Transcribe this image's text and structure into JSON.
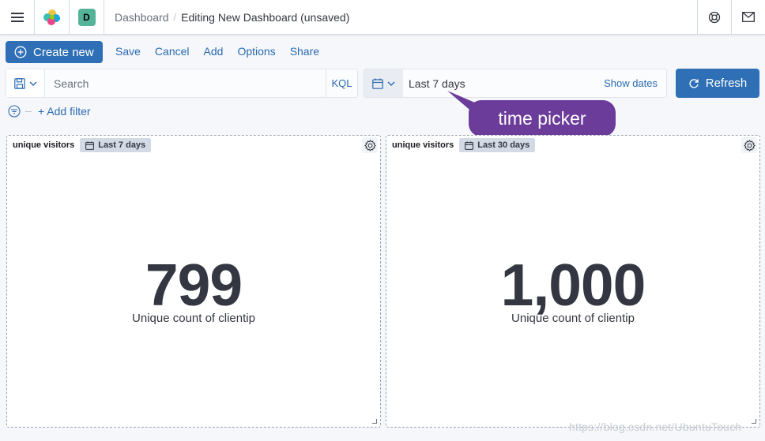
{
  "header": {
    "space_initial": "D",
    "breadcrumbs": [
      "Dashboard",
      "Editing New Dashboard (unsaved)"
    ]
  },
  "top_nav": {
    "create_new": "Create new",
    "links": [
      "Save",
      "Cancel",
      "Add",
      "Options",
      "Share"
    ]
  },
  "query_bar": {
    "search_placeholder": "Search",
    "language": "KQL"
  },
  "date_picker": {
    "label": "Last 7 days",
    "show_dates": "Show dates"
  },
  "refresh_label": "Refresh",
  "add_filter": "+ Add filter",
  "annotation": "time picker",
  "panels": [
    {
      "title": "unique visitors",
      "time_range": "Last 7 days",
      "value": "799",
      "metric_label": "Unique count of clientip"
    },
    {
      "title": "unique visitors",
      "time_range": "Last 30 days",
      "value": "1,000",
      "metric_label": "Unique count of clientip"
    }
  ],
  "watermark": "https://blog.csdn.net/UbuntuTouch",
  "colors": {
    "primary": "#2f6fb5",
    "link": "#2a6ab1",
    "annotation": "#6b3c9a",
    "space_badge": "#54b399"
  }
}
